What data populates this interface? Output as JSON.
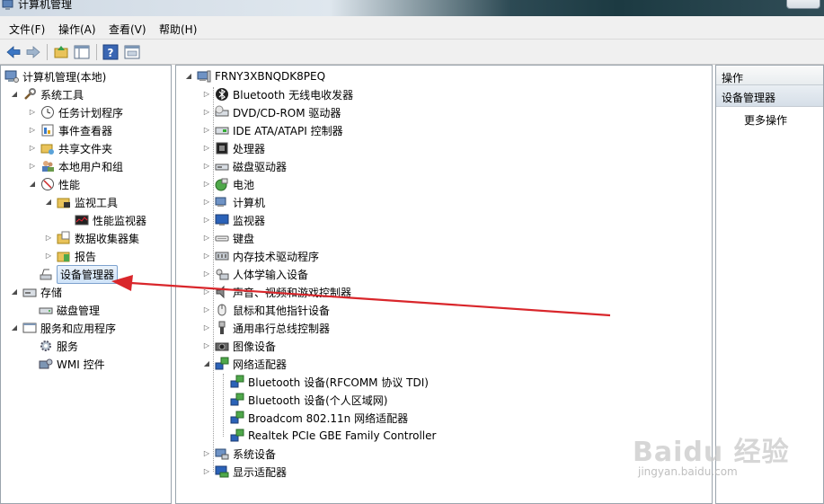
{
  "window": {
    "title": "计算机管理"
  },
  "menu": [
    {
      "label": "文件(F)"
    },
    {
      "label": "操作(A)"
    },
    {
      "label": "查看(V)"
    },
    {
      "label": "帮助(H)"
    }
  ],
  "toolbar": {
    "buttons": [
      "back-icon",
      "forward-icon",
      "up-folder-icon",
      "show-hide-tree-icon",
      "help-icon",
      "properties-icon"
    ]
  },
  "left_tree": {
    "root": "计算机管理(本地)",
    "system_tools": "系统工具",
    "task_scheduler": "任务计划程序",
    "event_viewer": "事件查看器",
    "shared_folders": "共享文件夹",
    "local_users": "本地用户和组",
    "performance": "性能",
    "monitoring_tools": "监视工具",
    "perf_monitor": "性能监视器",
    "data_collector": "数据收集器集",
    "reports": "报告",
    "device_manager": "设备管理器",
    "storage": "存储",
    "disk_management": "磁盘管理",
    "services_apps": "服务和应用程序",
    "services": "服务",
    "wmi": "WMI 控件"
  },
  "device_tree": {
    "computer_name": "FRNY3XBNQDK8PEQ",
    "categories": [
      {
        "label": "Bluetooth 无线电收发器",
        "icon": "bluetooth-icon"
      },
      {
        "label": "DVD/CD-ROM 驱动器",
        "icon": "dvd-drive-icon"
      },
      {
        "label": "IDE ATA/ATAPI 控制器",
        "icon": "ide-controller-icon"
      },
      {
        "label": "处理器",
        "icon": "processor-icon"
      },
      {
        "label": "磁盘驱动器",
        "icon": "disk-drive-icon"
      },
      {
        "label": "电池",
        "icon": "battery-icon"
      },
      {
        "label": "计算机",
        "icon": "computer-icon"
      },
      {
        "label": "监视器",
        "icon": "monitor-icon"
      },
      {
        "label": "键盘",
        "icon": "keyboard-icon"
      },
      {
        "label": "内存技术驱动程序",
        "icon": "memory-icon"
      },
      {
        "label": "人体学输入设备",
        "icon": "hid-icon"
      },
      {
        "label": "声音、视频和游戏控制器",
        "icon": "sound-icon"
      },
      {
        "label": "鼠标和其他指针设备",
        "icon": "mouse-icon"
      },
      {
        "label": "通用串行总线控制器",
        "icon": "usb-icon"
      },
      {
        "label": "图像设备",
        "icon": "camera-icon"
      },
      {
        "label": "网络适配器",
        "icon": "network-adapter-icon"
      }
    ],
    "network_children": [
      "Bluetooth 设备(RFCOMM 协议 TDI)",
      "Bluetooth 设备(个人区域网)",
      "Broadcom 802.11n 网络适配器",
      "Realtek PCIe GBE Family Controller"
    ],
    "tail_categories": [
      {
        "label": "系统设备",
        "icon": "system-devices-icon"
      },
      {
        "label": "显示适配器",
        "icon": "display-adapter-icon"
      }
    ]
  },
  "actions": {
    "header": "操作",
    "section": "设备管理器",
    "more": "更多操作"
  },
  "annotation": {
    "color": "#d9262b"
  },
  "watermark": {
    "logo": "Baidu 经验",
    "url": "jingyan.baidu.com"
  }
}
